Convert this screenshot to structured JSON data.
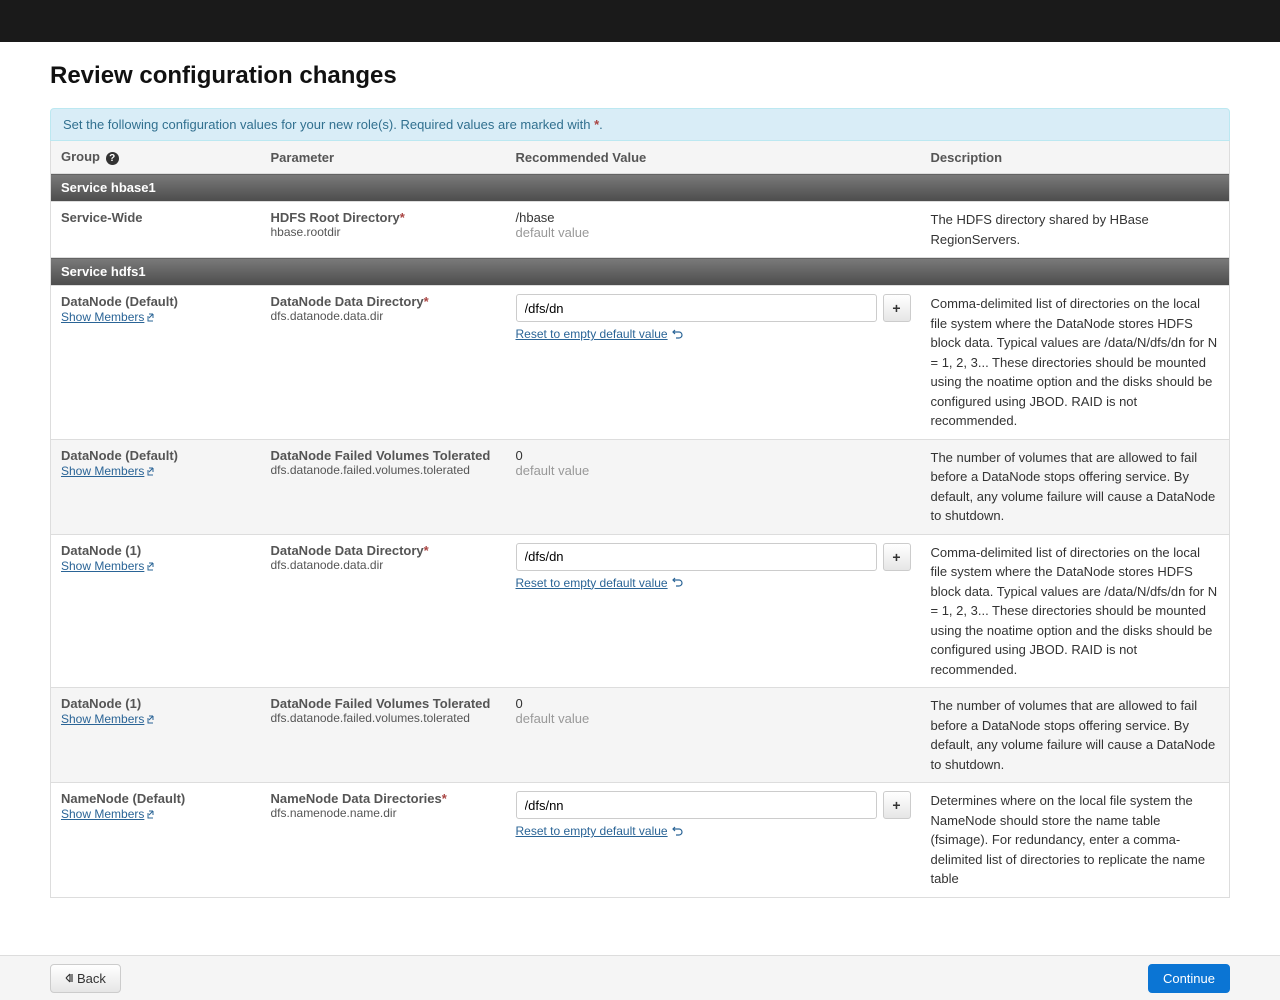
{
  "page_title": "Review configuration changes",
  "banner_text": "Set the following configuration values for your new role(s). Required values are marked with ",
  "banner_marker": "*",
  "banner_period": ".",
  "columns": {
    "group": "Group",
    "parameter": "Parameter",
    "value": "Recommended Value",
    "desc": "Description"
  },
  "show_members_label": "Show Members",
  "reset_label": "Reset to empty default value",
  "default_value_label": "default value",
  "service_headers": {
    "hbase1": "Service hbase1",
    "hdfs1": "Service hdfs1"
  },
  "rows": {
    "hbase_root": {
      "group": "Service-Wide",
      "param_name": "HDFS Root Directory",
      "param_key": "hbase.rootdir",
      "required": true,
      "value": "/hbase",
      "desc": "The HDFS directory shared by HBase RegionServers."
    },
    "dn_default_dir": {
      "group": "DataNode (Default)",
      "param_name": "DataNode Data Directory",
      "param_key": "dfs.datanode.data.dir",
      "required": true,
      "value": "/dfs/dn",
      "desc": "Comma-delimited list of directories on the local file system where the DataNode stores HDFS block data. Typical values are /data/N/dfs/dn for N = 1, 2, 3... These directories should be mounted using the noatime option and the disks should be configured using JBOD. RAID is not recommended."
    },
    "dn_default_fail": {
      "group": "DataNode (Default)",
      "param_name": "DataNode Failed Volumes Tolerated",
      "param_key": "dfs.datanode.failed.volumes.tolerated",
      "required": false,
      "value": "0",
      "desc": "The number of volumes that are allowed to fail before a DataNode stops offering service. By default, any volume failure will cause a DataNode to shutdown."
    },
    "dn1_dir": {
      "group": "DataNode (1)",
      "param_name": "DataNode Data Directory",
      "param_key": "dfs.datanode.data.dir",
      "required": true,
      "value": "/dfs/dn",
      "desc": "Comma-delimited list of directories on the local file system where the DataNode stores HDFS block data. Typical values are /data/N/dfs/dn for N = 1, 2, 3... These directories should be mounted using the noatime option and the disks should be configured using JBOD. RAID is not recommended."
    },
    "dn1_fail": {
      "group": "DataNode (1)",
      "param_name": "DataNode Failed Volumes Tolerated",
      "param_key": "dfs.datanode.failed.volumes.tolerated",
      "required": false,
      "value": "0",
      "desc": "The number of volumes that are allowed to fail before a DataNode stops offering service. By default, any volume failure will cause a DataNode to shutdown."
    },
    "nn_default_dir": {
      "group": "NameNode (Default)",
      "param_name": "NameNode Data Directories",
      "param_key": "dfs.namenode.name.dir",
      "required": true,
      "value": "/dfs/nn",
      "desc": "Determines where on the local file system the NameNode should store the name table (fsimage). For redundancy, enter a comma-delimited list of directories to replicate the name table"
    }
  },
  "footer": {
    "back": "Back",
    "continue": "Continue"
  }
}
